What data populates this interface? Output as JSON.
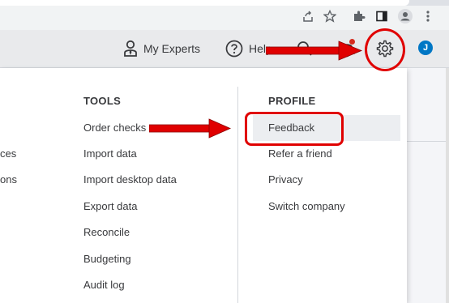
{
  "appbar": {
    "my_experts": "My Experts",
    "help": "Help",
    "avatar_initial": "J"
  },
  "left_partial": {
    "items": [
      "ces",
      "ons"
    ]
  },
  "tools": {
    "heading": "TOOLS",
    "items": [
      "Order checks",
      "Import data",
      "Import desktop data",
      "Export data",
      "Reconcile",
      "Budgeting",
      "Audit log"
    ]
  },
  "profile": {
    "heading": "PROFILE",
    "items": [
      "Feedback",
      "Refer a friend",
      "Privacy",
      "Switch company"
    ]
  },
  "colors": {
    "annotation_red": "#e00000",
    "avatar_blue": "#0077c5"
  }
}
